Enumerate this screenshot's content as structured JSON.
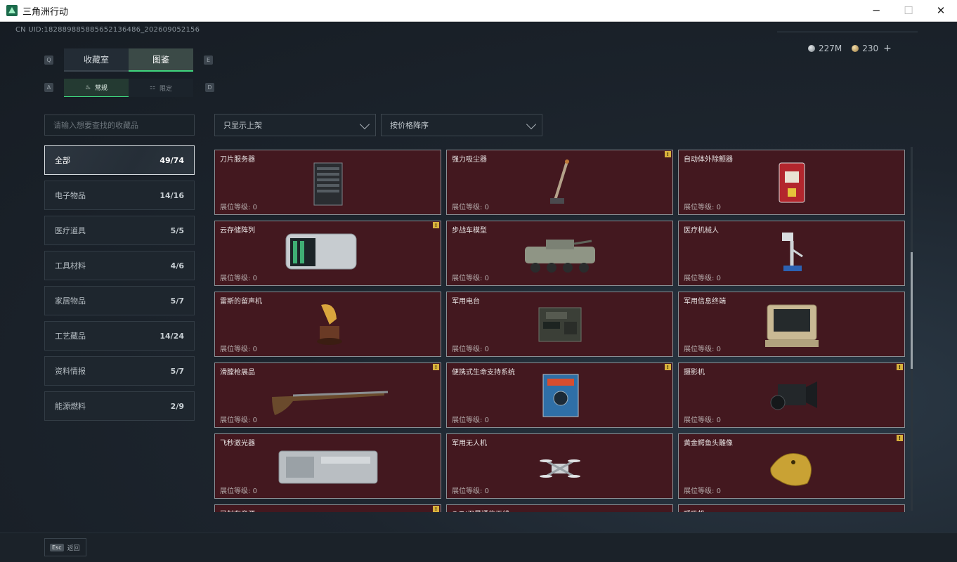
{
  "window": {
    "title": "三角洲行动",
    "minimize_icon": "─",
    "maximize_icon": "☐",
    "close_icon": "✕"
  },
  "header": {
    "uid": "CN UID:1828898858856521364​86_202609052156",
    "currency": [
      {
        "icon": "silver-coin-icon",
        "value": "227M"
      },
      {
        "icon": "gold-coin-icon",
        "value": "230"
      }
    ],
    "add_label": "+"
  },
  "main_tabs": {
    "key_left": "Q",
    "key_right": "E",
    "items": [
      {
        "label": "收藏室",
        "active": false
      },
      {
        "label": "图鉴",
        "active": true
      }
    ]
  },
  "sub_tabs": {
    "key_left": "A",
    "key_right": "D",
    "items": [
      {
        "label": "常规",
        "icon": "♨",
        "active": true
      },
      {
        "label": "限定",
        "icon": "⚏",
        "active": false
      }
    ]
  },
  "search": {
    "placeholder": "请输入想要查找的收藏品"
  },
  "filters": {
    "shelf": "只显示上架",
    "sort": "按价格降序"
  },
  "categories": [
    {
      "label": "全部",
      "count": "49/74",
      "active": true
    },
    {
      "label": "电子物品",
      "count": "14/16",
      "active": false
    },
    {
      "label": "医疗道具",
      "count": "5/5",
      "active": false
    },
    {
      "label": "工具材料",
      "count": "4/6",
      "active": false
    },
    {
      "label": "家居物品",
      "count": "5/7",
      "active": false
    },
    {
      "label": "工艺藏品",
      "count": "14/24",
      "active": false
    },
    {
      "label": "资料情报",
      "count": "5/7",
      "active": false
    },
    {
      "label": "能源燃料",
      "count": "2/9",
      "active": false
    }
  ],
  "level_label": "展位等级:",
  "items": [
    {
      "name": "刀片服务器",
      "level": "0",
      "badge": false,
      "icon": "server-icon"
    },
    {
      "name": "强力吸尘器",
      "level": "0",
      "badge": true,
      "icon": "vacuum-icon"
    },
    {
      "name": "自动体外除颤器",
      "level": "0",
      "badge": false,
      "icon": "defibrillator-icon"
    },
    {
      "name": "云存储阵列",
      "level": "0",
      "badge": true,
      "icon": "storage-array-icon"
    },
    {
      "name": "步战车模型",
      "level": "0",
      "badge": false,
      "icon": "ifv-model-icon"
    },
    {
      "name": "医疗机械人",
      "level": "0",
      "badge": false,
      "icon": "medical-robot-icon"
    },
    {
      "name": "雷斯的留声机",
      "level": "0",
      "badge": false,
      "icon": "gramophone-icon"
    },
    {
      "name": "军用电台",
      "level": "0",
      "badge": false,
      "icon": "military-radio-icon"
    },
    {
      "name": "军用信息终端",
      "level": "0",
      "badge": false,
      "icon": "terminal-icon"
    },
    {
      "name": "滑膛枪展品",
      "level": "0",
      "badge": true,
      "icon": "musket-icon"
    },
    {
      "name": "便携式生命支持系统",
      "level": "0",
      "badge": true,
      "icon": "life-support-icon"
    },
    {
      "name": "摄影机",
      "level": "0",
      "badge": true,
      "icon": "camera-icon"
    },
    {
      "name": "飞秒激光器",
      "level": "0",
      "badge": false,
      "icon": "laser-icon"
    },
    {
      "name": "军用无人机",
      "level": "0",
      "badge": false,
      "icon": "drone-icon"
    },
    {
      "name": "黄金鳄鱼头雕像",
      "level": "0",
      "badge": true,
      "icon": "crocodile-statue-icon"
    },
    {
      "name": "已封存音源",
      "level": "",
      "badge": true,
      "icon": "sealed-audio-icon"
    },
    {
      "name": "G.T.I卫星通信天线",
      "level": "",
      "badge": false,
      "icon": "antenna-icon"
    },
    {
      "name": "呼吸机",
      "level": "",
      "badge": false,
      "icon": "ventilator-icon"
    }
  ],
  "badge_mark": "!",
  "footer": {
    "esc_key": "Esc",
    "back_label": "返回"
  }
}
